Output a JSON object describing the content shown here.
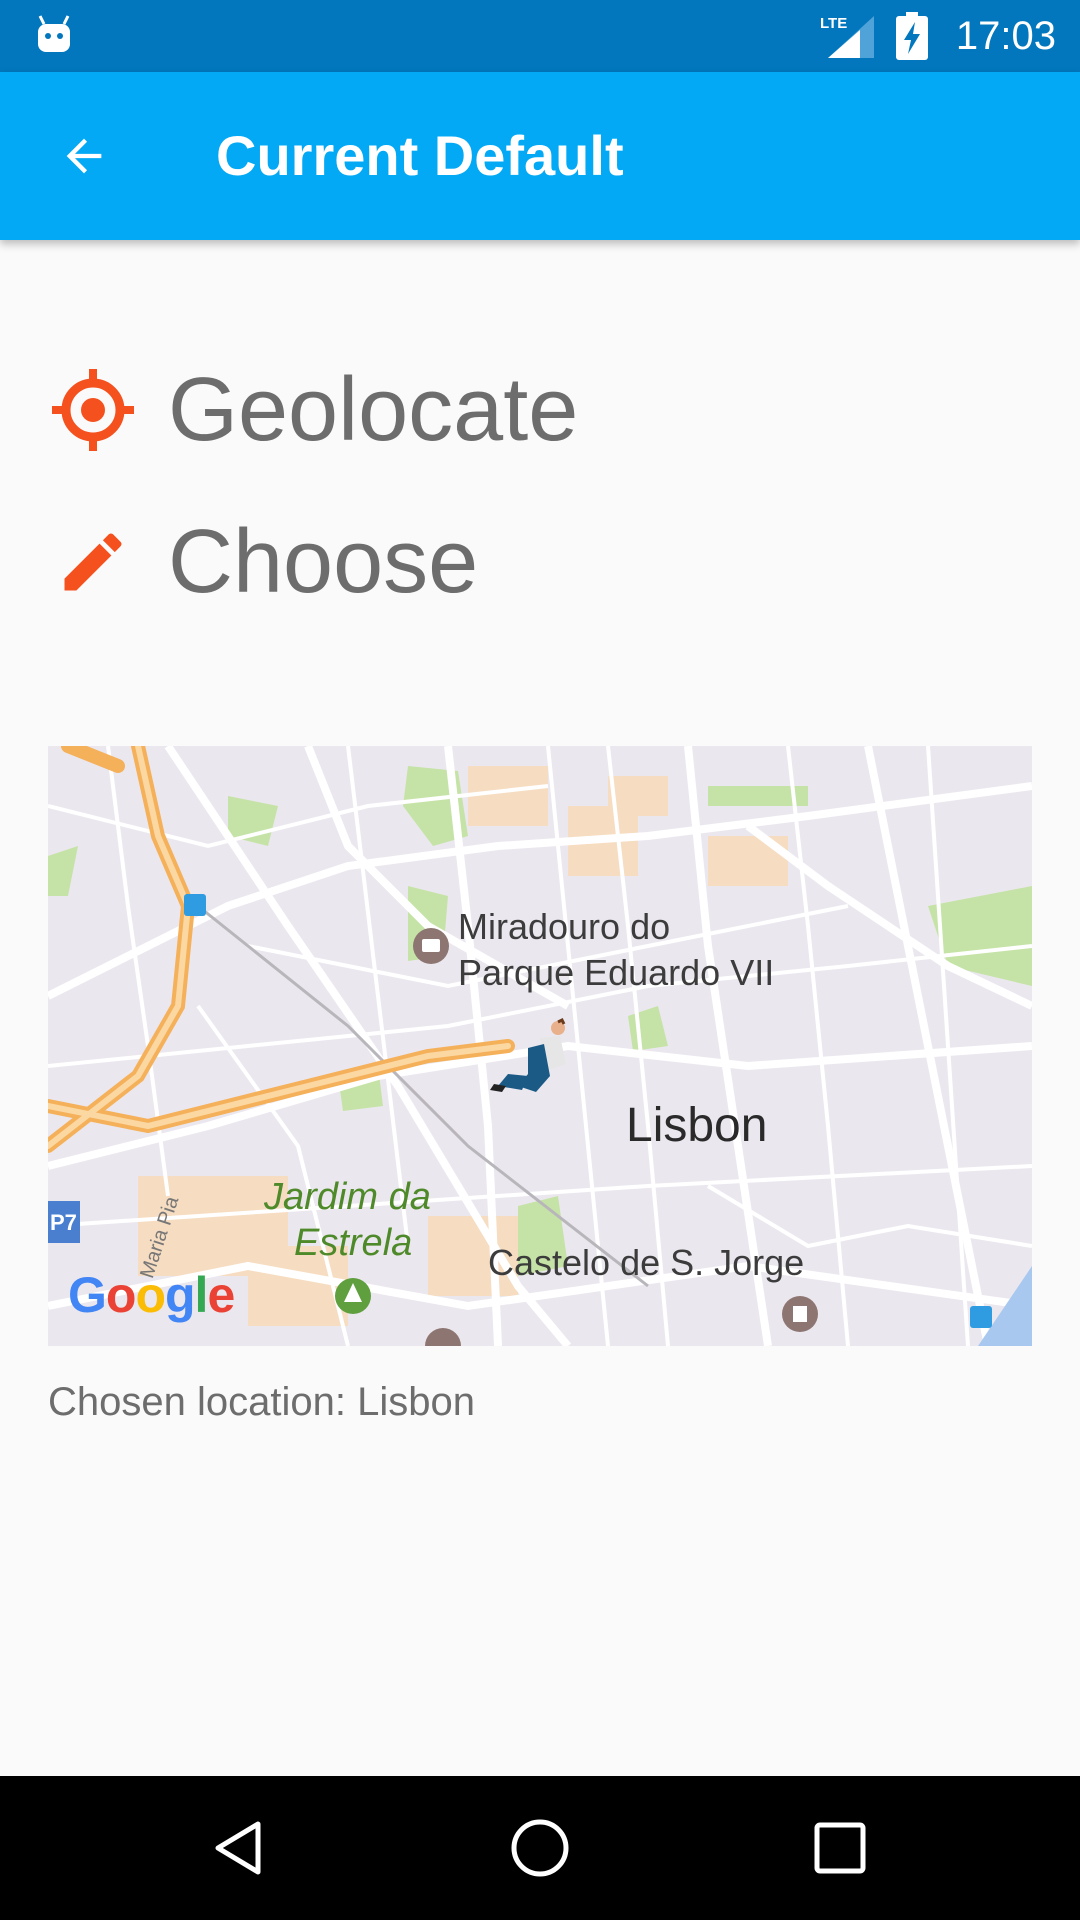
{
  "status_bar": {
    "time": "17:03",
    "network": "LTE",
    "icons": [
      "android-debug-icon",
      "lte-signal-icon",
      "battery-charging-icon"
    ]
  },
  "app_bar": {
    "title": "Current Default",
    "back_icon": "arrow-back-icon"
  },
  "actions": [
    {
      "label": "Geolocate",
      "icon": "crosshair-icon"
    },
    {
      "label": "Choose",
      "icon": "pencil-icon"
    }
  ],
  "map": {
    "labels": {
      "poi_1_line1": "Miradouro do",
      "poi_1_line2": "Parque Eduardo VII",
      "city": "Lisbon",
      "park_line1": "Jardim da",
      "park_line2": "Estrela",
      "castle": "Castelo de S. Jorge",
      "street": "Maria Pia",
      "route_badge": "P7"
    },
    "google_logo": {
      "G": "G",
      "o1": "o",
      "o2": "o",
      "g": "g",
      "l": "l",
      "e": "e"
    },
    "marker_icon": "street-view-person-icon"
  },
  "chosen_location_text": "Chosen location: Lisbon",
  "colors": {
    "status_bar": "#0277bd",
    "app_bar": "#03a9f4",
    "accent": "#f4511e",
    "text_secondary": "#6d6d6d"
  },
  "nav_bar": {
    "icons": [
      "back-triangle-icon",
      "home-circle-icon",
      "recents-square-icon"
    ]
  }
}
